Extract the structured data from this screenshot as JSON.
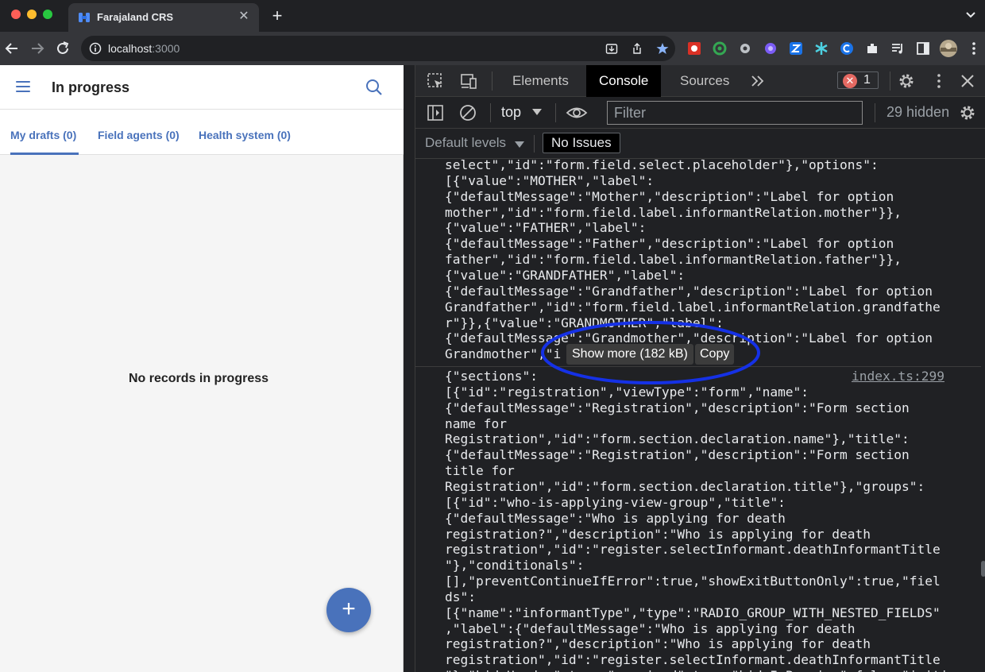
{
  "browser": {
    "tab_title": "Farajaland CRS",
    "url_host": "localhost",
    "url_port": ":3000"
  },
  "app": {
    "page_title": "In progress",
    "tabs": [
      {
        "label": "My drafts (0)"
      },
      {
        "label": "Field agents (0)"
      },
      {
        "label": "Health system (0)"
      }
    ],
    "empty_message": "No records in progress",
    "fab_label": "+",
    "accent_color": "#4972bb"
  },
  "devtools": {
    "tabs": [
      "Elements",
      "Console",
      "Sources"
    ],
    "active_tab": "Console",
    "error_count": "1",
    "context": "top",
    "filter_placeholder": "Filter",
    "hidden_count": "29 hidden",
    "levels_label": "Default levels",
    "issues_label": "No Issues",
    "message1_lines": [
      "select\",\"id\":\"form.field.select.placeholder\"},\"options\":",
      "[{\"value\":\"MOTHER\",\"label\":",
      "{\"defaultMessage\":\"Mother\",\"description\":\"Label for option",
      "mother\",\"id\":\"form.field.label.informantRelation.mother\"}},",
      "{\"value\":\"FATHER\",\"label\":",
      "{\"defaultMessage\":\"Father\",\"description\":\"Label for option",
      "father\",\"id\":\"form.field.label.informantRelation.father\"}},",
      "{\"value\":\"GRANDFATHER\",\"label\":",
      "{\"defaultMessage\":\"Grandfather\",\"description\":\"Label for option",
      "Grandfather\",\"id\":\"form.field.label.informantRelation.grandfathe",
      "r\"}},{\"value\":\"GRANDMOTHER\",\"label\":",
      "{\"defaultMessage\":\"Grandmother\",\"description\":\"Label for option",
      "Grandmother\",\"i"
    ],
    "show_more_label": "Show more (182 kB)",
    "copy_label": "Copy",
    "message2_source": "index.ts:299",
    "message2_lines": [
      "{\"sections\":",
      "[{\"id\":\"registration\",\"viewType\":\"form\",\"name\":",
      "{\"defaultMessage\":\"Registration\",\"description\":\"Form section",
      "name for",
      "Registration\",\"id\":\"form.section.declaration.name\"},\"title\":",
      "{\"defaultMessage\":\"Registration\",\"description\":\"Form section",
      "title for",
      "Registration\",\"id\":\"form.section.declaration.title\"},\"groups\":",
      "[{\"id\":\"who-is-applying-view-group\",\"title\":",
      "{\"defaultMessage\":\"Who is applying for death",
      "registration?\",\"description\":\"Who is applying for death",
      "registration\",\"id\":\"register.selectInformant.deathInformantTitle",
      "\"},\"conditionals\":",
      "[],\"preventContinueIfError\":true,\"showExitButtonOnly\":true,\"fiel",
      "ds\":",
      "[{\"name\":\"informantType\",\"type\":\"RADIO_GROUP_WITH_NESTED_FIELDS\"",
      ",\"label\":{\"defaultMessage\":\"Who is applying for death",
      "registration?\",\"description\":\"Who is applying for death",
      "registration\",\"id\":\"register.selectInformant.deathInformantTitle",
      "\"},\"hideHeader\":true,\"required\":true,\"hideInPreview\":false,\"initi"
    ],
    "annotation_color": "#1531e6"
  }
}
